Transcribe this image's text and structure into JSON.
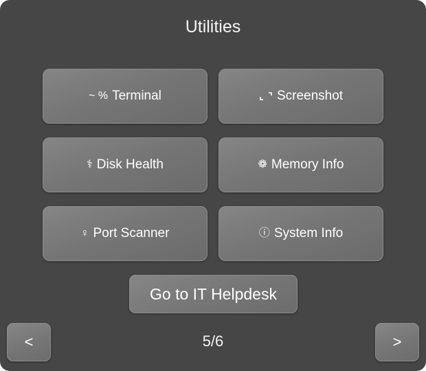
{
  "title": "Utilities",
  "tiles": [
    {
      "icon": "~ %",
      "icon_name": "terminal-icon",
      "label": "Terminal"
    },
    {
      "icon": "⌞⌝",
      "icon_name": "screenshot-icon",
      "label": "Screenshot"
    },
    {
      "icon": "⚕",
      "icon_name": "disk-health-icon",
      "label": "Disk Health"
    },
    {
      "icon": "❁",
      "icon_name": "memory-icon",
      "label": "Memory Info"
    },
    {
      "icon": "♀",
      "icon_name": "port-icon",
      "label": "Port Scanner"
    },
    {
      "icon": "ⓘ",
      "icon_name": "info-icon",
      "label": "System Info"
    }
  ],
  "helpdesk_label": "Go to IT Helpdesk",
  "nav": {
    "prev_label": "<",
    "next_label": ">",
    "page": "5/6"
  },
  "colors": {
    "background": "#464646",
    "button": "#777777",
    "text": "#ffffff"
  }
}
